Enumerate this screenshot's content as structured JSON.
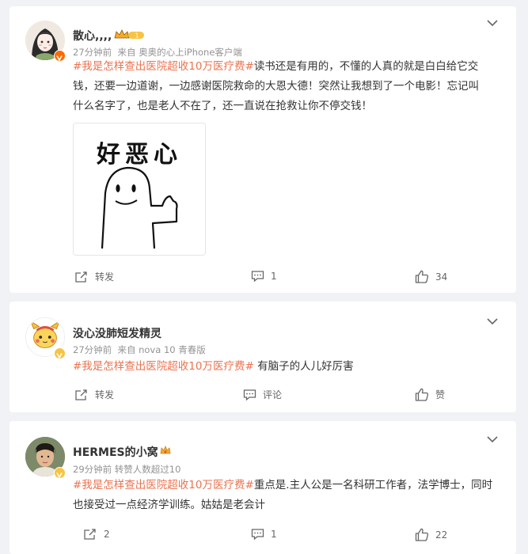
{
  "colors": {
    "tag": "#eb7350",
    "meta": "#939393",
    "badge_orange": "#ff6a00",
    "badge_yellow": "#f7c342"
  },
  "posts": [
    {
      "username": "散心,,,,",
      "vip_level": "1",
      "time": "27分钟前",
      "source": "来自 奥奥的心上iPhone客户端",
      "hashtag": "#我是怎样查出医院超收10万医疗费#",
      "line1": "读书还是有用的，不懂的人真的就是白白给它交",
      "line2": "钱，还要一边道谢，一边感谢医院救命的大恩大德！突然让我想到了一个电影！忘记叫",
      "line3": "什么名字了，也是老人不在了，还一直说在抢救让你不停交钱！",
      "image_caption": "好恶心",
      "repost": "转发",
      "comment": "1",
      "like": "34"
    },
    {
      "username": "没心没肺短发精灵",
      "time": "27分钟前",
      "source": "来自 nova 10 青春版",
      "hashtag": "#我是怎样查出医院超收10万医疗费#",
      "line1": " 有脑子的人儿好厉害",
      "repost": "转发",
      "comment": "评论",
      "like": "赞"
    },
    {
      "username": "HERMES的小窝",
      "time": "29分钟前",
      "source": "转赞人数超过10",
      "hashtag": "#我是怎样查出医院超收10万医疗费#",
      "line1": "重点是.主人公是一名科研工作者，法学博士，同时",
      "line2": "也接受过一点经济学训练。姑姑是老会计",
      "repost": "2",
      "comment": "1",
      "like": "22"
    }
  ]
}
